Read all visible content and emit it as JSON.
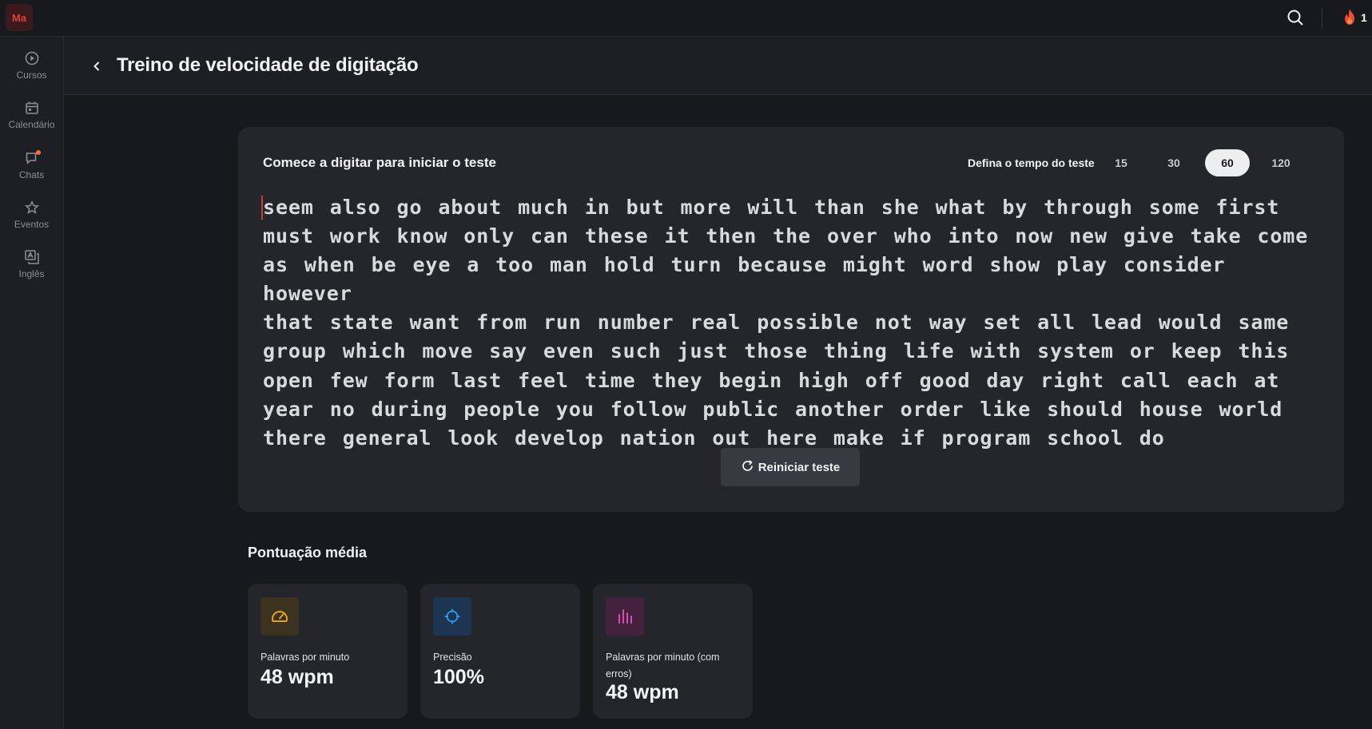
{
  "app": {
    "logo_text": "Ma",
    "streak_count": "1"
  },
  "sidebar": {
    "items": [
      {
        "label": "Cursos",
        "icon": "play-circle-icon"
      },
      {
        "label": "Calendário",
        "icon": "calendar-icon"
      },
      {
        "label": "Chats",
        "icon": "chat-icon",
        "has_notification": true
      },
      {
        "label": "Eventos",
        "icon": "star-icon"
      },
      {
        "label": "Inglês",
        "icon": "translate-icon"
      }
    ]
  },
  "header": {
    "title": "Treino de velocidade de digitação"
  },
  "test": {
    "hint": "Comece a digitar para iniciar o teste",
    "time_label": "Defina o tempo do teste",
    "time_options": [
      "15",
      "30",
      "60",
      "120"
    ],
    "selected_time": "60",
    "lines": [
      "seem also go about much in but more will than she what by through some first",
      "must work know only can these it then the over who into now new give take come",
      "as when be eye a too man hold turn because might word show play consider however",
      "that state want from run number real possible not way set all lead would same",
      "group which move say even such just those thing life with system or keep this",
      "open few form last feel time they begin high off good day right call each at",
      "year no during people you follow public another order like should house world",
      "there general look develop nation out here make if program school do"
    ],
    "restart_label": "Reiniciar teste"
  },
  "stats": {
    "title": "Pontuação média",
    "cards": [
      {
        "label": "Palavras por minuto",
        "value": "48 wpm",
        "icon": "speedometer-icon",
        "color": "#e3a31b"
      },
      {
        "label": "Precisão",
        "value": "100%",
        "icon": "crosshair-icon",
        "color": "#2f9bf0"
      },
      {
        "label": "Palavras por minuto (com erros)",
        "value": "48 wpm",
        "icon": "bar-chart-icon",
        "color": "#d94fae"
      }
    ]
  },
  "colors": {
    "accent": "#e0403a",
    "background": "#18191d",
    "card": "#25262c"
  }
}
